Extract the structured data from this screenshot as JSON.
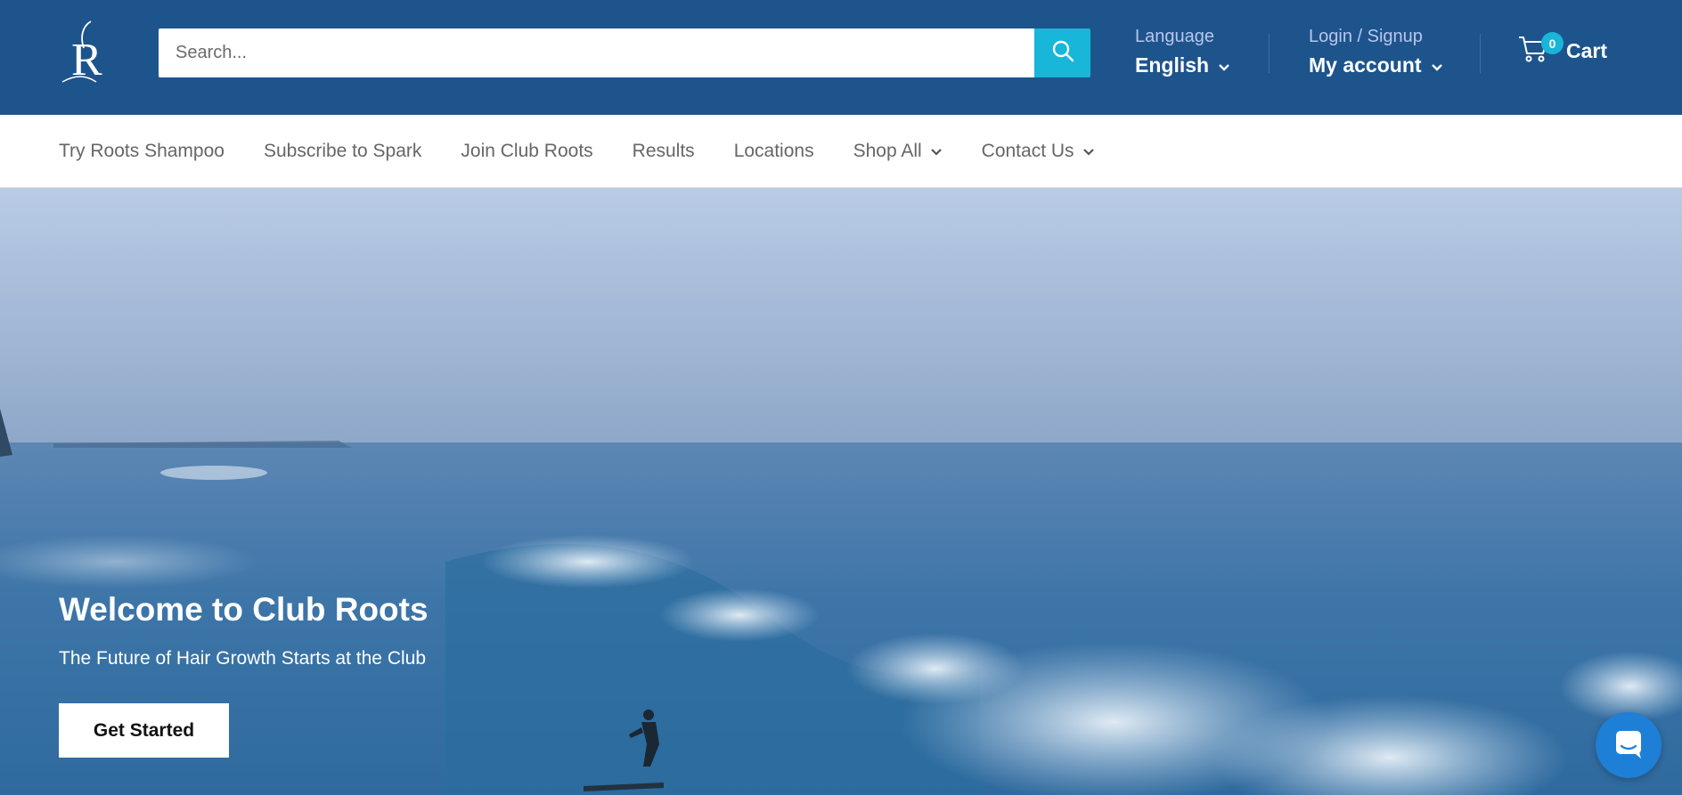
{
  "colors": {
    "header_bg": "#1e548c",
    "accent": "#18b6d9",
    "chat": "#1e7fd6"
  },
  "header": {
    "logo_icon": "roots-logo-icon",
    "search": {
      "placeholder": "Search...",
      "button_icon": "search-icon"
    },
    "language": {
      "label": "Language",
      "value": "English"
    },
    "account": {
      "label": "Login / Signup",
      "value": "My account"
    },
    "cart": {
      "count": "0",
      "label": "Cart",
      "icon": "cart-icon"
    }
  },
  "nav": {
    "items": [
      {
        "label": "Try Roots Shampoo"
      },
      {
        "label": "Subscribe to Spark"
      },
      {
        "label": "Join Club Roots"
      },
      {
        "label": "Results"
      },
      {
        "label": "Locations"
      },
      {
        "label": "Shop All",
        "dropdown": true
      },
      {
        "label": "Contact Us",
        "dropdown": true
      }
    ]
  },
  "hero": {
    "title": "Welcome to Club Roots",
    "subtitle": "The Future of Hair Growth Starts at the Club",
    "cta": "Get Started"
  },
  "chat": {
    "icon": "chat-icon"
  }
}
